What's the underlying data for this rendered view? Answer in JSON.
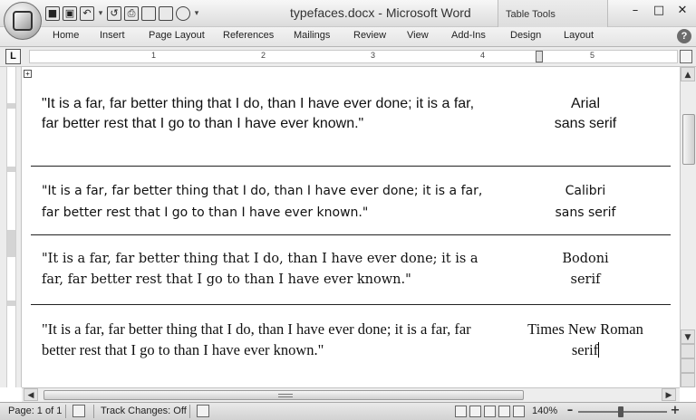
{
  "window": {
    "title": "typefaces.docx - Microsoft Word",
    "contextual_tab_group": "Table Tools",
    "controls": {
      "minimize": "–",
      "maximize": "□",
      "close": "✕"
    }
  },
  "quick_access": {
    "save": "■",
    "open": "▣",
    "undo": "↶",
    "redo": "↺",
    "print": "⎙",
    "customize": "▾"
  },
  "ribbon": {
    "tabs": [
      "Home",
      "Insert",
      "Page Layout",
      "References",
      "Mailings",
      "Review",
      "View",
      "Add-Ins",
      "Design",
      "Layout"
    ],
    "help": "?"
  },
  "ruler": {
    "tab_selector": "L",
    "numbers": [
      "1",
      "2",
      "3",
      "4",
      "5"
    ]
  },
  "document": {
    "table_move_handle": "+",
    "rows": [
      {
        "quote": "\"It is a far, far better thing that I do, than I have ever done; it is a far, far better rest that I go to than I have ever known.\"",
        "font_name": "Arial",
        "font_class": "sans serif"
      },
      {
        "quote": "\"It is a far, far better thing that I do, than I have ever done; it is a far, far better rest that I go to than I have ever known.\"",
        "font_name": "Calibri",
        "font_class": "sans serif"
      },
      {
        "quote": "\"It is a far, far better thing that I do, than I have ever done; it is a far, far better rest that I go to than I have ever known.\"",
        "font_name": "Bodoni",
        "font_class": "serif"
      },
      {
        "quote": "\"It is a far, far better thing that I do, than I have ever done; it is a far, far better rest that I go to than I have ever known.\"",
        "font_name": "Times New Roman",
        "font_class": "serif"
      }
    ]
  },
  "scrollbars": {
    "up": "▲",
    "down": "▼",
    "left": "◀",
    "right": "▶"
  },
  "statusbar": {
    "page": "Page: 1 of 1",
    "track_changes": "Track Changes: Off",
    "zoom_level": "140%",
    "zoom_out": "–",
    "zoom_in": "+"
  }
}
